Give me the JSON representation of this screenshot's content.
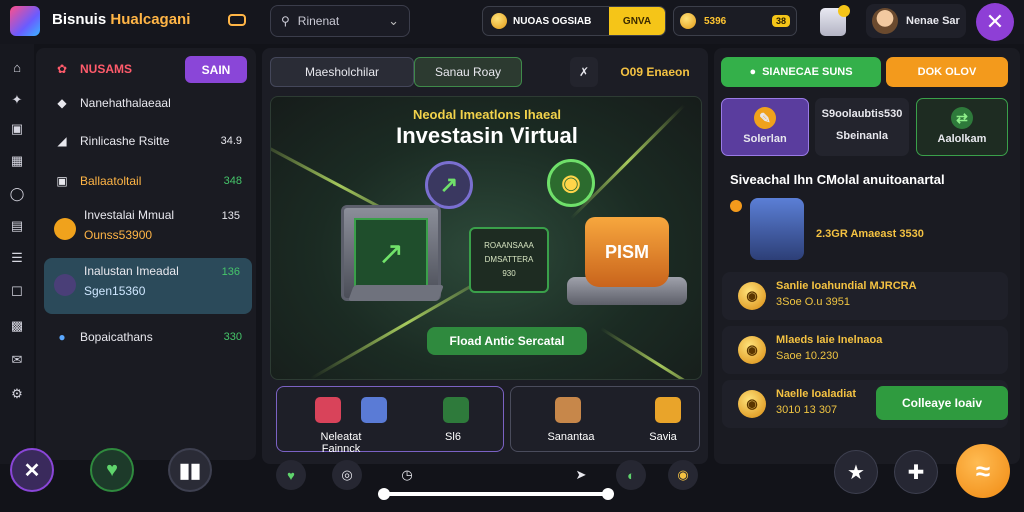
{
  "header": {
    "brand_part1": "Bisnuis",
    "brand_part2": "Hualcagani",
    "search_text": "Rinenat",
    "balance_label": "NUOAS OGSIAB",
    "balance_button": "GNVA",
    "coins_value": "5396",
    "coins_badge": "38",
    "user_name": "Nenae Sar",
    "accent_color": "#8e3fd6"
  },
  "sidebar": {
    "header_label": "NUSAMS",
    "header_button": "SAIN",
    "items": [
      {
        "label": "Nanehathalaeaal",
        "value": ""
      },
      {
        "label": "Rinlicashe Rsitte",
        "value": "34.9"
      },
      {
        "label": "Ballaatoltail",
        "value": "348"
      },
      {
        "label": "Investalai Mmual",
        "sub": "Ounss53900",
        "value": "135"
      },
      {
        "label": "Inalustan Imeadal",
        "sub": "Sgen15360",
        "value": "136"
      },
      {
        "label": "Bopaicathans",
        "value": "330"
      }
    ]
  },
  "center": {
    "tab_active": "Maesholchilar",
    "tab_secondary": "Sanau Roay",
    "tab_right": "O09 Enaeon",
    "hero_small": "Neodal Imeatlons Ihaeal",
    "hero_title": "Investasin Virtual",
    "hero_card_lines": [
      "ROAANSAAA",
      "DMSATTERA",
      "930"
    ],
    "pot_label": "PISM",
    "hero_button": "Fload Antic Sercatal",
    "promo_a_caption": "Neleatat Fainnck",
    "promo_a_caption2": "Sl6",
    "promo_b_caption": "Sanantaa",
    "promo_b_caption2": "Savia"
  },
  "right": {
    "btn_green": "SIANECAE SUNS",
    "btn_orange": "DOK OLOV",
    "cats": [
      {
        "label": "Solerlan",
        "sub": ""
      },
      {
        "label": "Sbeinanla",
        "sub": "S9oolaubtis530"
      },
      {
        "label": "Aalolkam",
        "sub": ""
      }
    ],
    "feed_title": "Siveachal Ihn CMolal anuitoanartal",
    "agent_line": "2.3GR Amaeast 3530",
    "rows": [
      {
        "l1": "Sanlie Ioahundial MJRCRA",
        "l2": "3Soe O.u 3951"
      },
      {
        "l1": "Mlaeds Iaie Inelnaoa",
        "l2": "Saoe 10.230"
      },
      {
        "l1": "Naelle Ioaladiat",
        "l2": "3010 13 307"
      }
    ],
    "collect_button": "Colleaye Ioaiv"
  }
}
